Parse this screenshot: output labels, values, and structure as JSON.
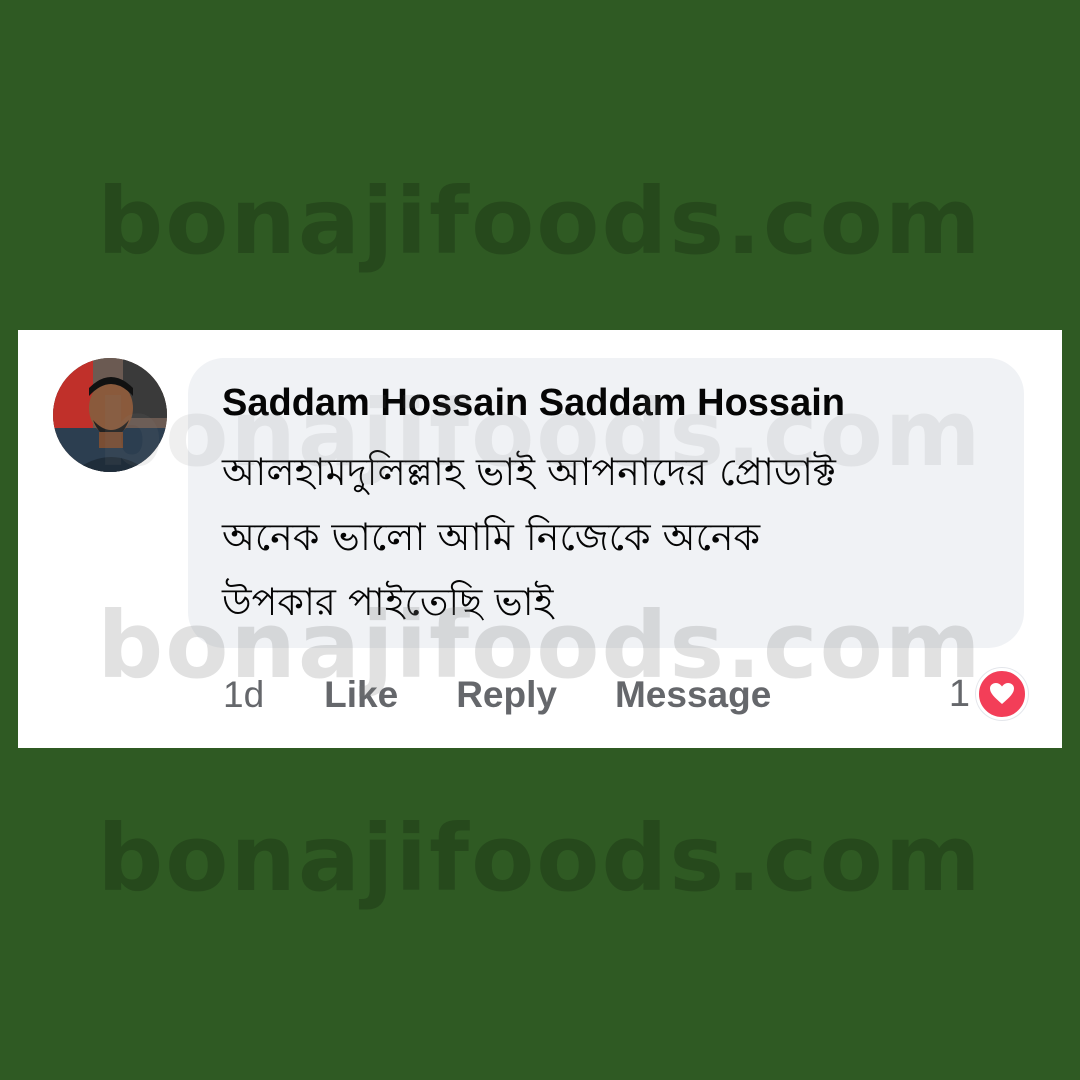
{
  "watermark": {
    "text": "bonajifoods.com"
  },
  "comment": {
    "author": "Saddam Hossain Saddam Hossain",
    "lines": [
      "আলহামদুলিল্লাহ ভাই আপনাদের প্রোডাক্ট",
      "অনেক ভালো আমি নিজেকে অনেক",
      "উপকার পাইতেছি ভাই"
    ],
    "timestamp": "1d",
    "actions": {
      "like": "Like",
      "reply": "Reply",
      "message": "Message"
    },
    "reaction_count": "1",
    "reaction_icon": "heart-icon"
  },
  "colors": {
    "background": "#2f5a23",
    "card": "#ffffff",
    "bubble": "#f0f2f5",
    "author_text": "#050505",
    "meta_text": "#65676b",
    "heart": "#f33e58"
  }
}
